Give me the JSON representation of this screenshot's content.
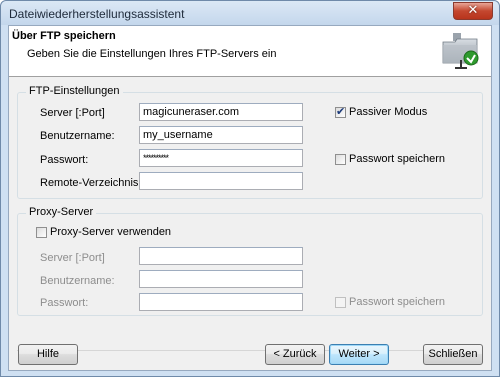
{
  "window": {
    "title": "Dateiwiederherstellungsassistent",
    "close_glyph": "✕"
  },
  "header": {
    "title": "Über FTP speichern",
    "subtitle": "Geben Sie die Einstellungen Ihres FTP-Servers ein",
    "icon": "folder-network-icon"
  },
  "ftp": {
    "group_title": "FTP-Einstellungen",
    "server_label": "Server [:Port]",
    "server_value": "magicuneraser.com",
    "username_label": "Benutzername:",
    "username_value": "my_username",
    "password_label": "Passwort:",
    "password_value": "**********",
    "remote_dir_label": "Remote-Verzeichnis:",
    "remote_dir_value": "",
    "passive_label": "Passiver Modus",
    "passive_checked": true,
    "save_password_label": "Passwort speichern",
    "save_password_checked": false
  },
  "proxy": {
    "group_title": "Proxy-Server",
    "use_proxy_label": "Proxy-Server verwenden",
    "use_proxy_checked": false,
    "server_label": "Server [:Port]",
    "server_value": "",
    "username_label": "Benutzername:",
    "username_value": "",
    "password_label": "Passwort:",
    "password_value": "",
    "save_password_label": "Passwort speichern",
    "save_password_checked": false
  },
  "buttons": {
    "help": "Hilfe",
    "back": "< Zurück",
    "next": "Weiter >",
    "close": "Schließen"
  }
}
